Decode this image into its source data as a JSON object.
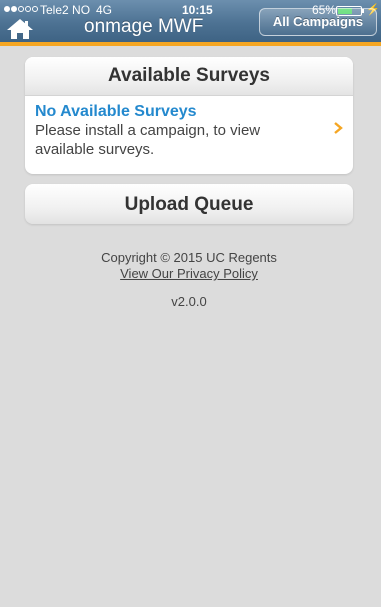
{
  "status_bar": {
    "carrier": "Tele2 NO",
    "network": "4G",
    "time": "10:15",
    "battery_percent": "65%",
    "battery_level": 0.65,
    "signal_bars": 2
  },
  "header": {
    "title": "onmage MWF",
    "campaigns_button_label": "All Campaigns",
    "accent_color": "#f5a623"
  },
  "surveys": {
    "heading": "Available Surveys",
    "items": [
      {
        "title": "No Available Surveys",
        "description": "Please install a campaign, to view available surveys."
      }
    ]
  },
  "upload_queue": {
    "label": "Upload Queue"
  },
  "footer": {
    "copyright": "Copyright © 2015 UC Regents",
    "privacy_link": "View Our Privacy Policy",
    "version": "v2.0.0"
  },
  "icons": {
    "home": "home-icon",
    "chevron": "chevron-right-icon",
    "charging": "charging-icon"
  }
}
